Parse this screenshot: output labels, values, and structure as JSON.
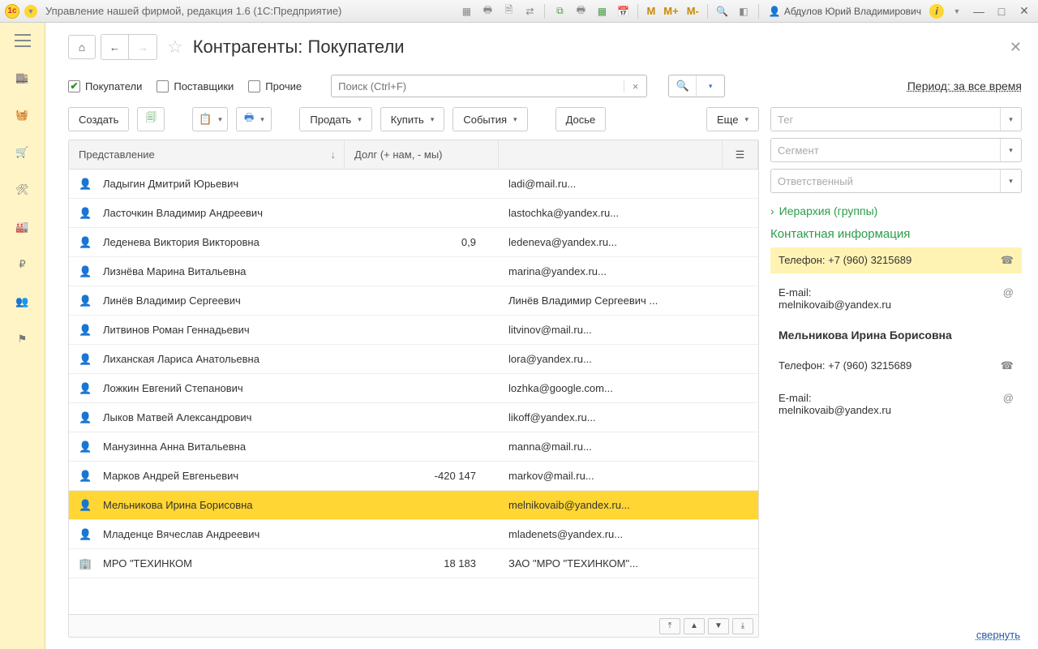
{
  "titlebar": {
    "app_title": "Управление нашей фирмой, редакция 1.6  (1С:Предприятие)",
    "user_name": "Абдулов Юрий Владимирович"
  },
  "page": {
    "title": "Контрагенты: Покупатели"
  },
  "filters": {
    "buyers": "Покупатели",
    "suppliers": "Поставщики",
    "others": "Прочие",
    "search_placeholder": "Поиск (Ctrl+F)",
    "period_label": "Период: за все время"
  },
  "toolbar": {
    "create": "Создать",
    "sell": "Продать",
    "buy": "Купить",
    "events": "События",
    "dossier": "Досье",
    "more": "Еще"
  },
  "columns": {
    "name": "Представление",
    "debt": "Долг (+ нам, - мы)"
  },
  "rows": [
    {
      "name": "Ладыгин Дмитрий Юрьевич",
      "debt": "",
      "email": "ladi@mail.ru...",
      "type": "person"
    },
    {
      "name": "Ласточкин Владимир Андреевич",
      "debt": "",
      "email": "lastochka@yandex.ru...",
      "type": "person"
    },
    {
      "name": "Леденева Виктория Викторовна",
      "debt": "0,9",
      "email": "ledeneva@yandex.ru...",
      "type": "person"
    },
    {
      "name": "Лизнёва Марина Витальевна",
      "debt": "",
      "email": "marina@yandex.ru...",
      "type": "person"
    },
    {
      "name": "Линёв Владимир Сергеевич",
      "debt": "",
      "email": "Линёв Владимир Сергеевич ...",
      "type": "person"
    },
    {
      "name": "Литвинов Роман Геннадьевич",
      "debt": "",
      "email": "litvinov@mail.ru...",
      "type": "person"
    },
    {
      "name": "Лиханская Лариса Анатольевна",
      "debt": "",
      "email": "lora@yandex.ru...",
      "type": "person"
    },
    {
      "name": "Ложкин Евгений Степанович",
      "debt": "",
      "email": "lozhka@google.com...",
      "type": "person"
    },
    {
      "name": "Лыков Матвей Александрович",
      "debt": "",
      "email": "likoff@yandex.ru...",
      "type": "person"
    },
    {
      "name": "Манузинна Анна Витальевна",
      "debt": "",
      "email": "manna@mail.ru...",
      "type": "person"
    },
    {
      "name": "Марков Андрей Евгеньевич",
      "debt": "-420 147",
      "email": "markov@mail.ru...",
      "type": "person"
    },
    {
      "name": "Мельникова Ирина Борисовна",
      "debt": "",
      "email": "melnikovaib@yandex.ru...",
      "type": "person",
      "selected": true
    },
    {
      "name": "Младенце Вячеслав Андреевич",
      "debt": "",
      "email": "mladenets@yandex.ru...",
      "type": "person"
    },
    {
      "name": "МРО \"ТЕХИНКОМ",
      "debt": "18 183",
      "email": "ЗАО \"МРО \"ТЕХИНКОМ\"...",
      "type": "org"
    }
  ],
  "side": {
    "tag_ph": "Тег",
    "segment_ph": "Сегмент",
    "responsible_ph": "Ответственный",
    "hierarchy": "Иерархия (группы)",
    "contact_info": "Контактная информация",
    "phone_label": "Телефон:",
    "phone_value": "+7 (960) 3215689",
    "email_label": "E-mail:",
    "email_value": "melnikovaib@yandex.ru",
    "contact_name": "Мельникова Ирина Борисовна",
    "phone2_label": "Телефон:",
    "phone2_value": "+7 (960) 3215689",
    "email2_label": "E-mail:",
    "email2_value": "melnikovaib@yandex.ru",
    "collapse": "свернуть"
  }
}
